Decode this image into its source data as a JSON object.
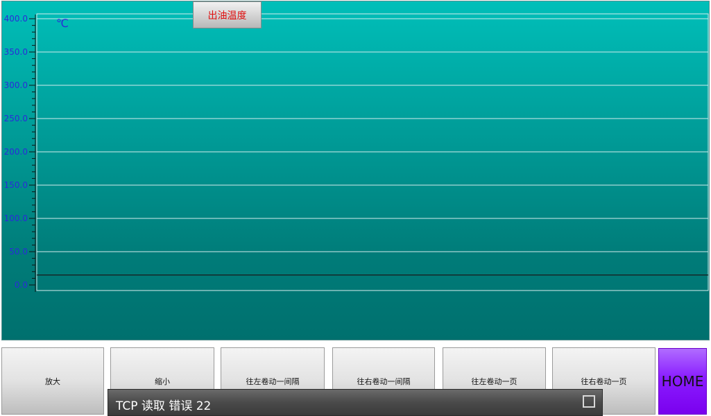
{
  "chart": {
    "title_button_label": "出油温度",
    "unit_label": "℃",
    "ylim": [
      0,
      400
    ],
    "y_ticks": [
      "400.0",
      "350.0",
      "300.0",
      "250.0",
      "200.0",
      "150.0",
      "100.0",
      "50.0",
      "0.0"
    ]
  },
  "chart_data": {
    "type": "line",
    "title": "出油温度",
    "xlabel": "",
    "ylabel": "℃",
    "ylim": [
      0,
      400
    ],
    "tick_labels_y": [
      "400.0",
      "350.0",
      "300.0",
      "250.0",
      "200.0",
      "150.0",
      "100.0",
      "50.0",
      "0.0"
    ],
    "grid": true,
    "series": [
      {
        "values": [
          15,
          15
        ]
      }
    ],
    "line_color": "#1a1a1a"
  },
  "toolbar": {
    "zoom_in_label": "放大",
    "zoom_out_label": "缩小",
    "scroll_left_interval_label": "往左卷动一间隔",
    "scroll_right_interval_label": "往右卷动一间隔",
    "scroll_left_page_label": "往左卷动一页",
    "scroll_right_page_label": "往右卷动一页",
    "home_label": "HOME"
  },
  "status": {
    "message": "TCP 读取 错误 22"
  },
  "colors": {
    "chart_background_top": "#00bfb9",
    "chart_background_bottom": "#00706e",
    "tick_label_color": "#2b2bd9",
    "title_text_color": "#e01010",
    "home_button_color": "#8a1cff",
    "status_bar_color": "#4a4a4a"
  }
}
